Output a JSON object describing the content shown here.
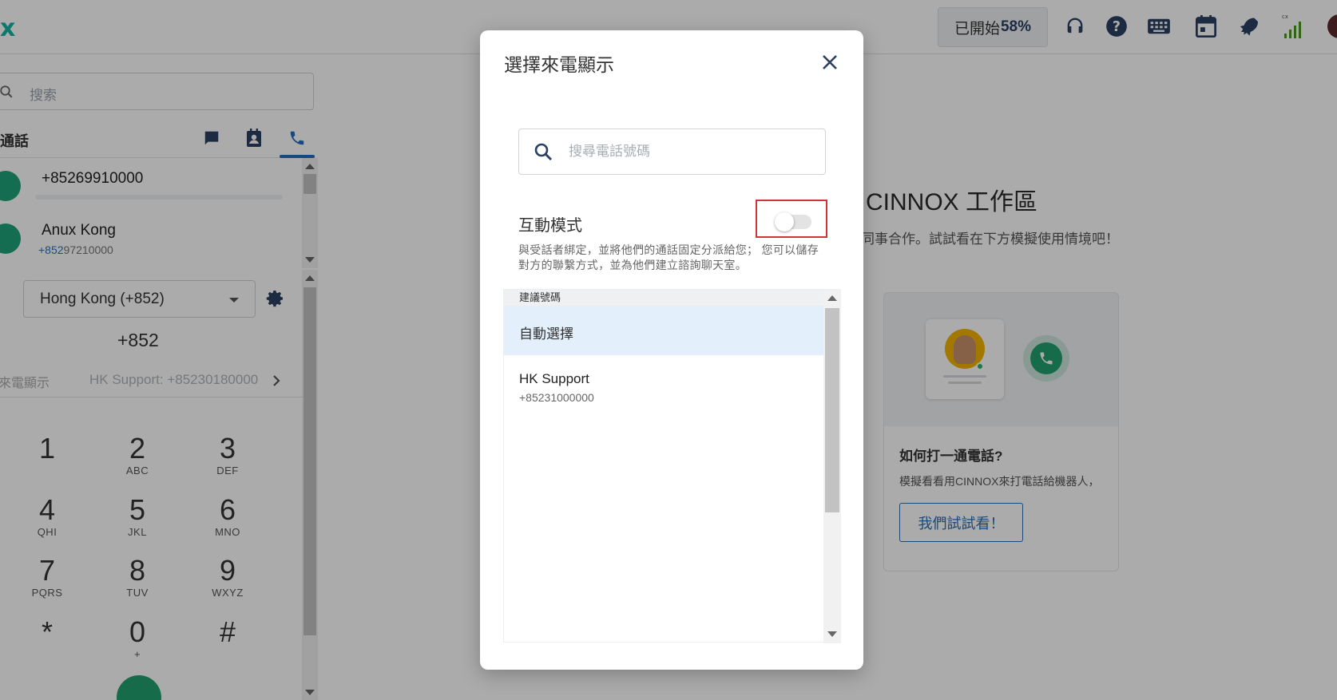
{
  "topbar": {
    "logo_text": "x",
    "progress_label": "已開始",
    "progress_value": "58%",
    "icons": [
      "headset-icon",
      "help-icon",
      "keyboard-icon",
      "calendar-icon",
      "rocket-icon",
      "signal-icon"
    ],
    "signal_label": "cx"
  },
  "left": {
    "search_placeholder": "搜索",
    "tab_label": "通話",
    "recent": [
      {
        "name": "+85269910000",
        "number": ""
      },
      {
        "name": "Anux Kong",
        "number_prefix": "+852",
        "number_rest": "97210000"
      }
    ],
    "country": "Hong Kong (+852)",
    "prefix": "+852",
    "caller_id_label": "來電顯示",
    "caller_id_value": "HK Support: +85230180000",
    "keypad": [
      {
        "d": "1",
        "s": ""
      },
      {
        "d": "2",
        "s": "ABC"
      },
      {
        "d": "3",
        "s": "DEF"
      },
      {
        "d": "4",
        "s": "QHI"
      },
      {
        "d": "5",
        "s": "JKL"
      },
      {
        "d": "6",
        "s": "MNO"
      },
      {
        "d": "7",
        "s": "PQRS"
      },
      {
        "d": "8",
        "s": "TUV"
      },
      {
        "d": "9",
        "s": "WXYZ"
      },
      {
        "d": "*",
        "s": ""
      },
      {
        "d": "0",
        "s": "+"
      },
      {
        "d": "#",
        "s": ""
      }
    ]
  },
  "workspace": {
    "title": "CINNOX 工作區",
    "subtitle": "同事合作。試試看在下方模擬使用情境吧！",
    "card_heading": "如何打一通電話?",
    "card_text": "模擬看看用CINNOX來打電話給機器人，",
    "card_button": "我們試試看！"
  },
  "modal": {
    "title": "選擇來電顯示",
    "search_placeholder": "搜尋電話號碼",
    "interactive_mode_label": "互動模式",
    "interactive_mode_on": false,
    "description": "與受話者綁定，並將他們的通話固定分派給您； 您可以儲存對方的聯繫方式，並為他們建立諮詢聊天室。",
    "list_header": "建議號碼",
    "options": [
      {
        "name": "自動選擇",
        "number": ""
      },
      {
        "name": "HK Support",
        "number": "+85231000000"
      }
    ]
  },
  "colors": {
    "brand_teal": "#17b3a3",
    "call_green": "#22a26f",
    "link_blue": "#2c6db0",
    "highlight_red": "#d0343b",
    "selected_row": "#e3f0fc"
  }
}
